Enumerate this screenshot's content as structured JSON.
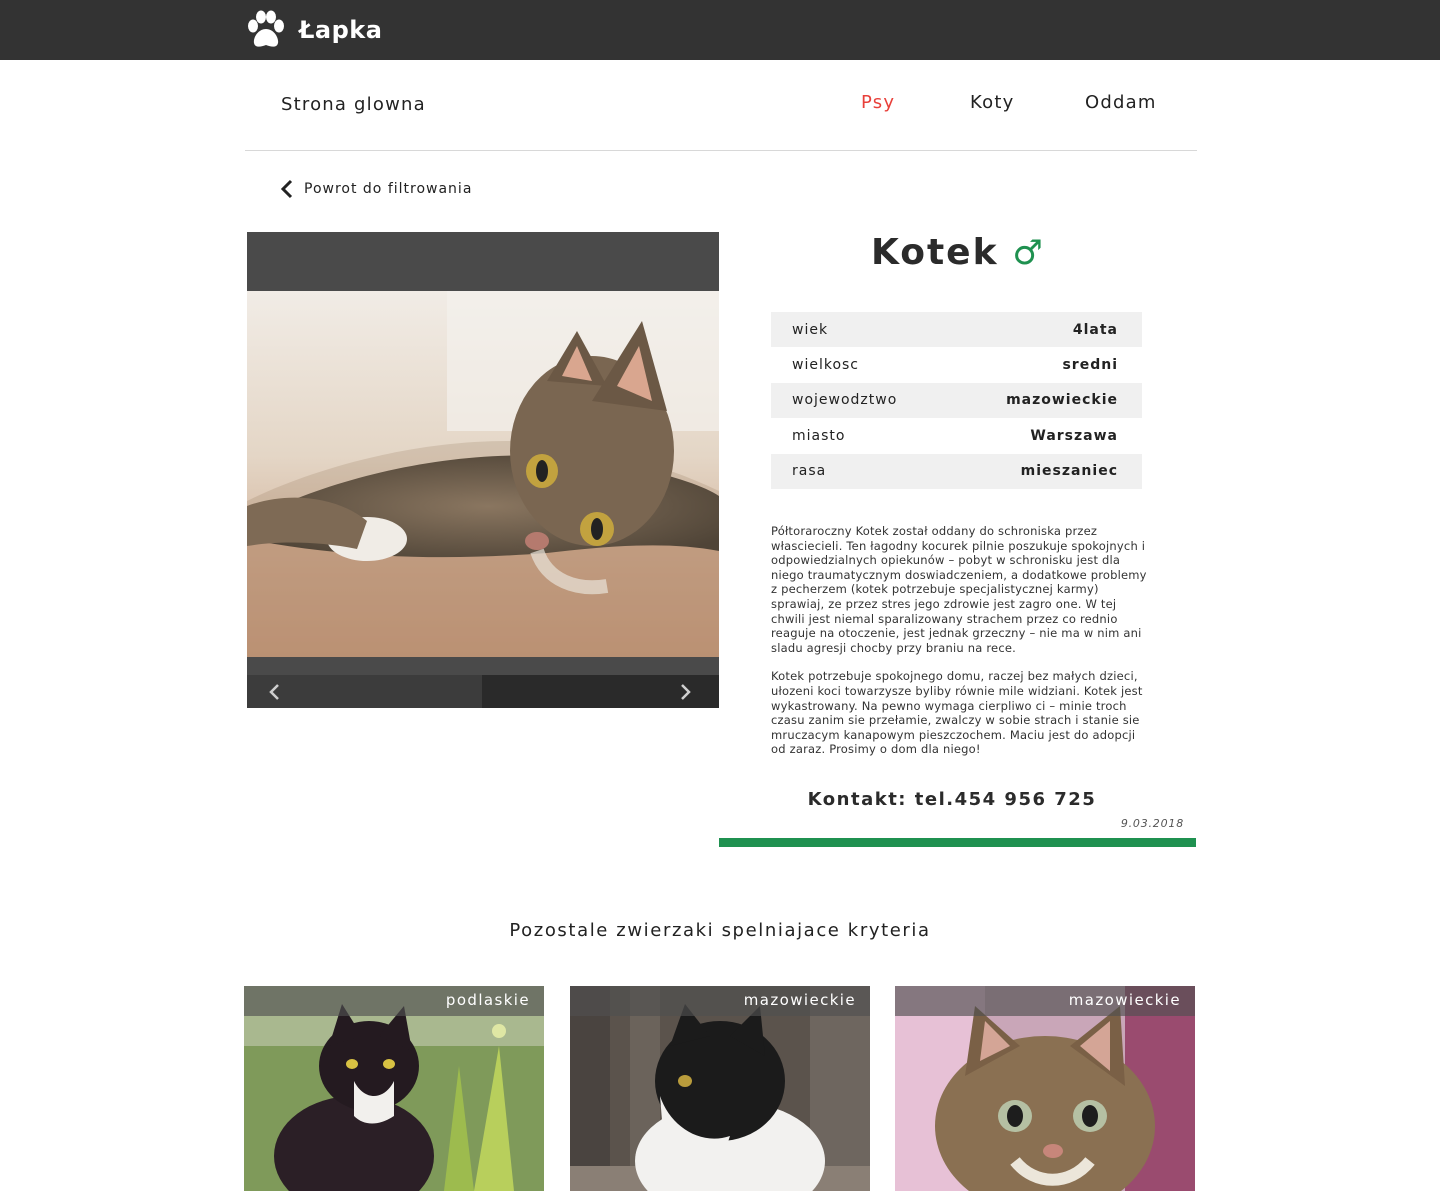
{
  "header": {
    "brand": "Łapka",
    "logo_icon": "paw-icon"
  },
  "nav": {
    "home": "Strona glowna",
    "links": [
      "Psy",
      "Koty",
      "Oddam"
    ],
    "active": "Psy",
    "active_color": "#e8403a"
  },
  "back_link": {
    "label": "Powrot do filtrowania",
    "icon": "chevron-left-icon"
  },
  "pet": {
    "name": "Kotek",
    "sex_symbol": "♂",
    "sex_color": "#1f9150",
    "attributes": [
      {
        "label": "wiek",
        "value": "4lata"
      },
      {
        "label": "wielkosc",
        "value": "sredni"
      },
      {
        "label": "wojewodztwo",
        "value": "mazowieckie"
      },
      {
        "label": "miasto",
        "value": "Warszawa"
      },
      {
        "label": "rasa",
        "value": "mieszaniec"
      }
    ],
    "description": [
      "Półtoraroczny Kotek został oddany do schroniska przez własciecieli. Ten łagodny kocurek pilnie poszukuje spokojnych i odpowiedzialnych opiekunów – pobyt w schronisku jest dla niego traumatycznym doswiadczeniem, a dodatkowe problemy z pecherzem (kotek potrzebuje specjalistycznej karmy) sprawiaj, ze przez stres jego zdrowie jest zagro one. W tej chwili jest niemal sparalizowany strachem przez co  rednio reaguje na otoczenie, jest jednak grzeczny – nie ma w nim ani sladu agresji chocby przy braniu na rece.",
      "Kotek potrzebuje spokojnego domu, raczej bez małych dzieci, ułozeni koci towarzysze byliby równie  mile widziani. Kotek jest wykastrowany. Na pewno wymaga cierpliwo ci – minie troch czasu zanim sie przełamie, zwalczy w sobie strach i stanie sie mruczacym kanapowym pieszczochem. Maciu  jest do adopcji od zaraz. Prosimy o dom dla niego!"
    ],
    "contact": "Kontakt: tel.454 956 725",
    "date": "9.03.2018",
    "accent_color": "#1f9150"
  },
  "gallery": {
    "prev_icon": "chevron-left-icon",
    "next_icon": "chevron-right-icon"
  },
  "others": {
    "title": "Pozostale zwierzaki spelniajace kryteria",
    "cards": [
      {
        "region": "podlaskie"
      },
      {
        "region": "mazowieckie"
      },
      {
        "region": "mazowieckie"
      }
    ]
  }
}
